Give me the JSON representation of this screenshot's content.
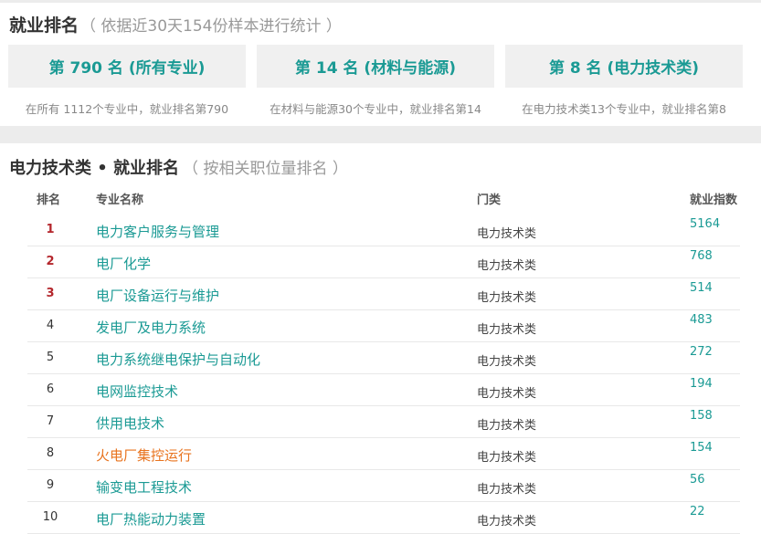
{
  "employment": {
    "title": "就业排名",
    "subtitle": "（ 依据近30天154份样本进行统计 ）",
    "cards": [
      {
        "label": "第 790 名 (所有专业)",
        "note": "在所有 1112个专业中，就业排名第790"
      },
      {
        "label": "第 14 名 (材料与能源)",
        "note": "在材料与能源30个专业中，就业排名第14"
      },
      {
        "label": "第 8 名 (电力技术类)",
        "note": "在电力技术类13个专业中，就业排名第8"
      }
    ]
  },
  "ranking": {
    "title": "电力技术类 • 就业排名",
    "subtitle": "（ 按相关职位量排名 ）",
    "headers": {
      "rank": "排名",
      "name": "专业名称",
      "category": "门类",
      "index": "就业指数"
    },
    "rows": [
      {
        "rank": "1",
        "name": "电力客户服务与管理",
        "category": "电力技术类",
        "index": "5164"
      },
      {
        "rank": "2",
        "name": "电厂化学",
        "category": "电力技术类",
        "index": "768"
      },
      {
        "rank": "3",
        "name": "电厂设备运行与维护",
        "category": "电力技术类",
        "index": "514"
      },
      {
        "rank": "4",
        "name": "发电厂及电力系统",
        "category": "电力技术类",
        "index": "483"
      },
      {
        "rank": "5",
        "name": "电力系统继电保护与自动化",
        "category": "电力技术类",
        "index": "272"
      },
      {
        "rank": "6",
        "name": "电网监控技术",
        "category": "电力技术类",
        "index": "194"
      },
      {
        "rank": "7",
        "name": "供用电技术",
        "category": "电力技术类",
        "index": "158"
      },
      {
        "rank": "8",
        "name": "火电厂集控运行",
        "category": "电力技术类",
        "index": "154"
      },
      {
        "rank": "9",
        "name": "输变电工程技术",
        "category": "电力技术类",
        "index": "56"
      },
      {
        "rank": "10",
        "name": "电厂热能动力装置",
        "category": "电力技术类",
        "index": "22"
      }
    ]
  },
  "colors": {
    "accent": "#1a9a94",
    "top_rank": "#b4262c",
    "highlight": "#e8731e"
  }
}
